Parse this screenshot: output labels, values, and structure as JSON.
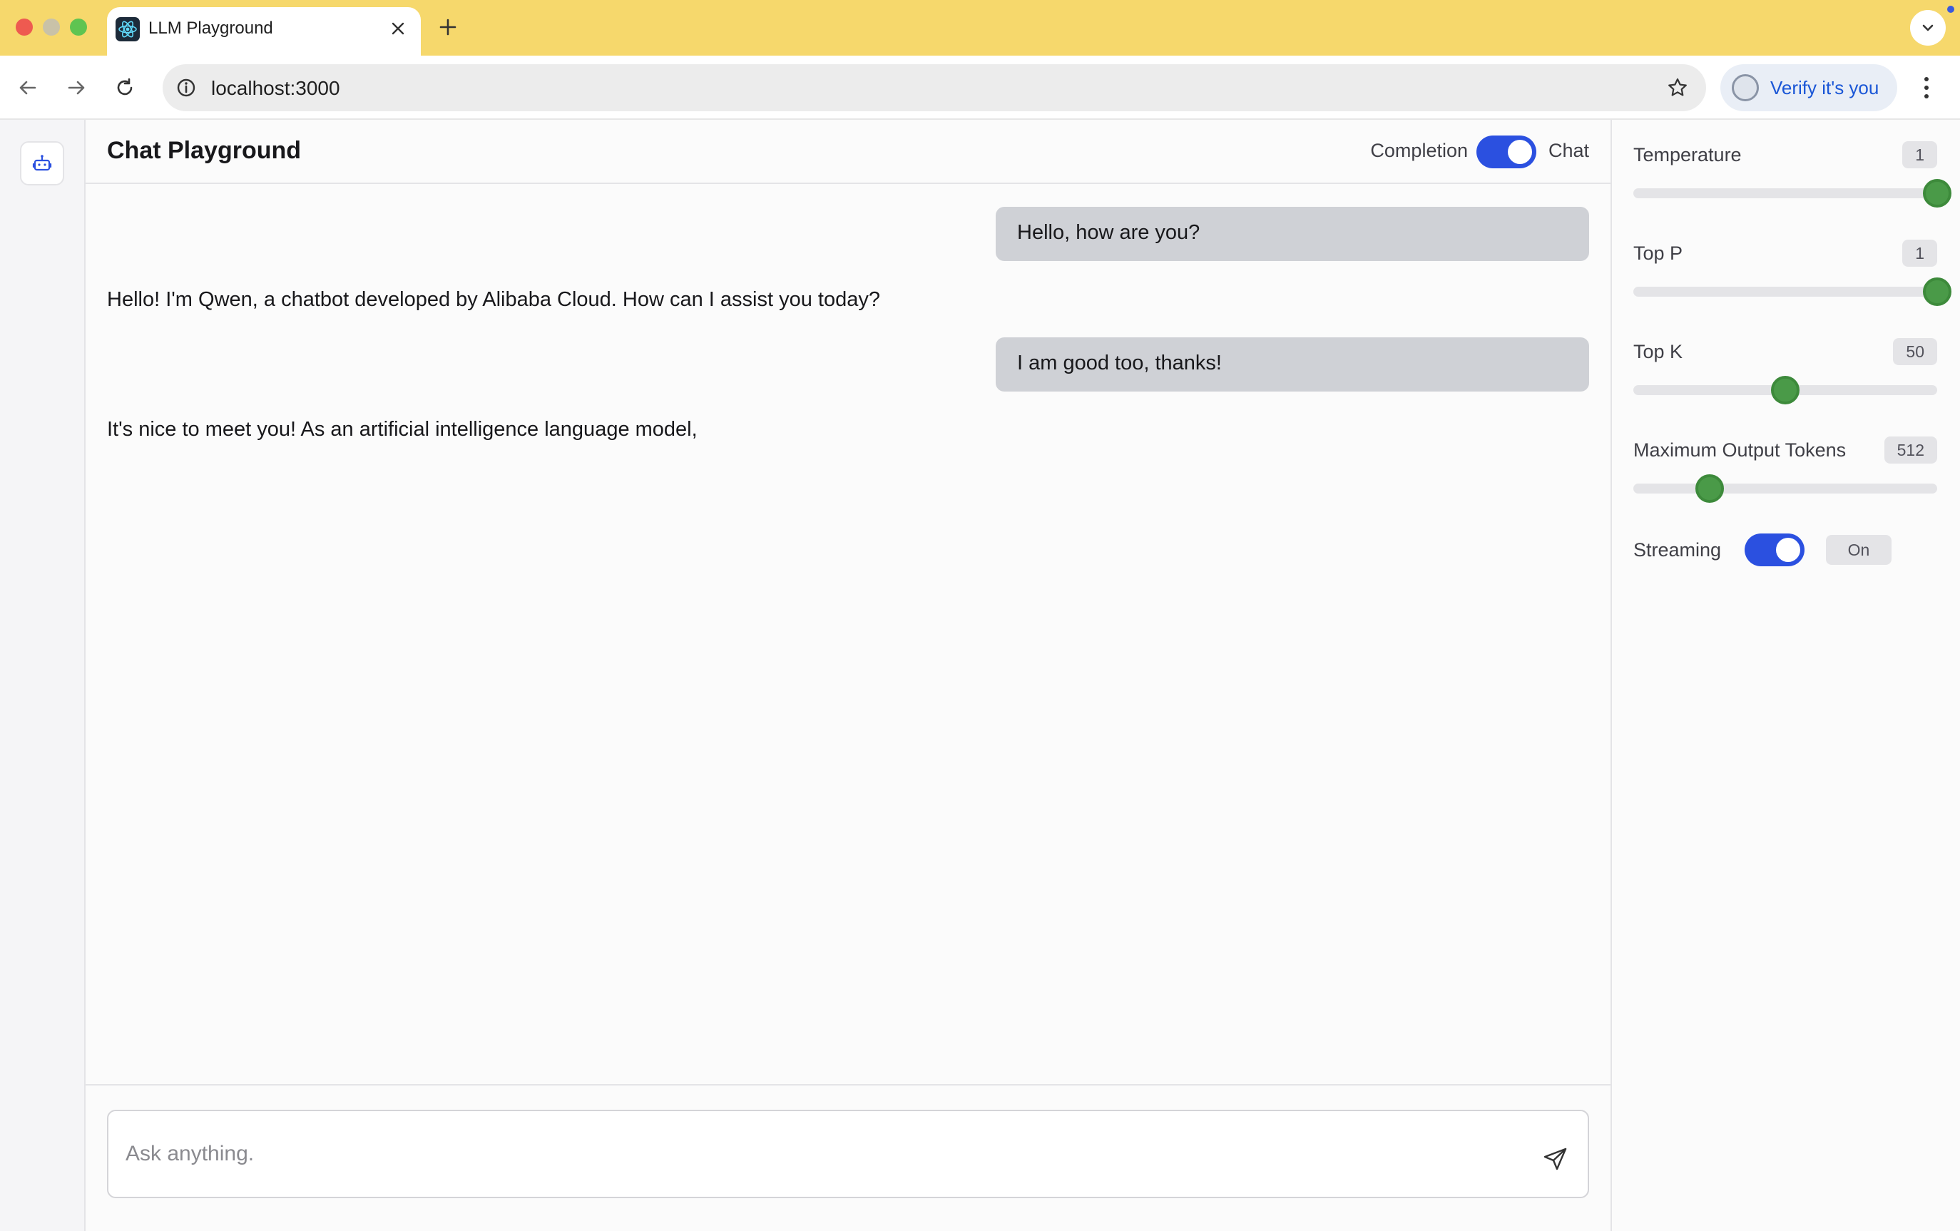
{
  "browser": {
    "tab_title": "LLM Playground",
    "url": "localhost:3000",
    "profile_label": "Verify it's you"
  },
  "app": {
    "title": "Chat Playground",
    "mode": {
      "left_label": "Completion",
      "right_label": "Chat",
      "selected": "Chat"
    }
  },
  "messages": [
    {
      "role": "user",
      "text": "Hello, how are you?"
    },
    {
      "role": "assistant",
      "text": "Hello! I'm Qwen, a chatbot developed by Alibaba Cloud. How can I assist you today?"
    },
    {
      "role": "user",
      "text": "I am good too, thanks!"
    },
    {
      "role": "assistant",
      "text": "It's nice to meet you! As an artificial intelligence language model,"
    }
  ],
  "composer": {
    "placeholder": "Ask anything."
  },
  "settings": {
    "temperature": {
      "label": "Temperature",
      "value": "1",
      "fraction": 1.0
    },
    "top_p": {
      "label": "Top P",
      "value": "1",
      "fraction": 1.0
    },
    "top_k": {
      "label": "Top K",
      "value": "50",
      "fraction": 0.5
    },
    "max_tokens": {
      "label": "Maximum Output Tokens",
      "value": "512",
      "fraction": 0.25
    },
    "streaming": {
      "label": "Streaming",
      "state": "On",
      "enabled": true
    }
  },
  "colors": {
    "tabbar": "#f6d86c",
    "toggle_on": "#2b50e0",
    "slider_thumb": "#4a9a48",
    "user_bubble": "#cfd1d6",
    "link_blue": "#1a56d6"
  }
}
